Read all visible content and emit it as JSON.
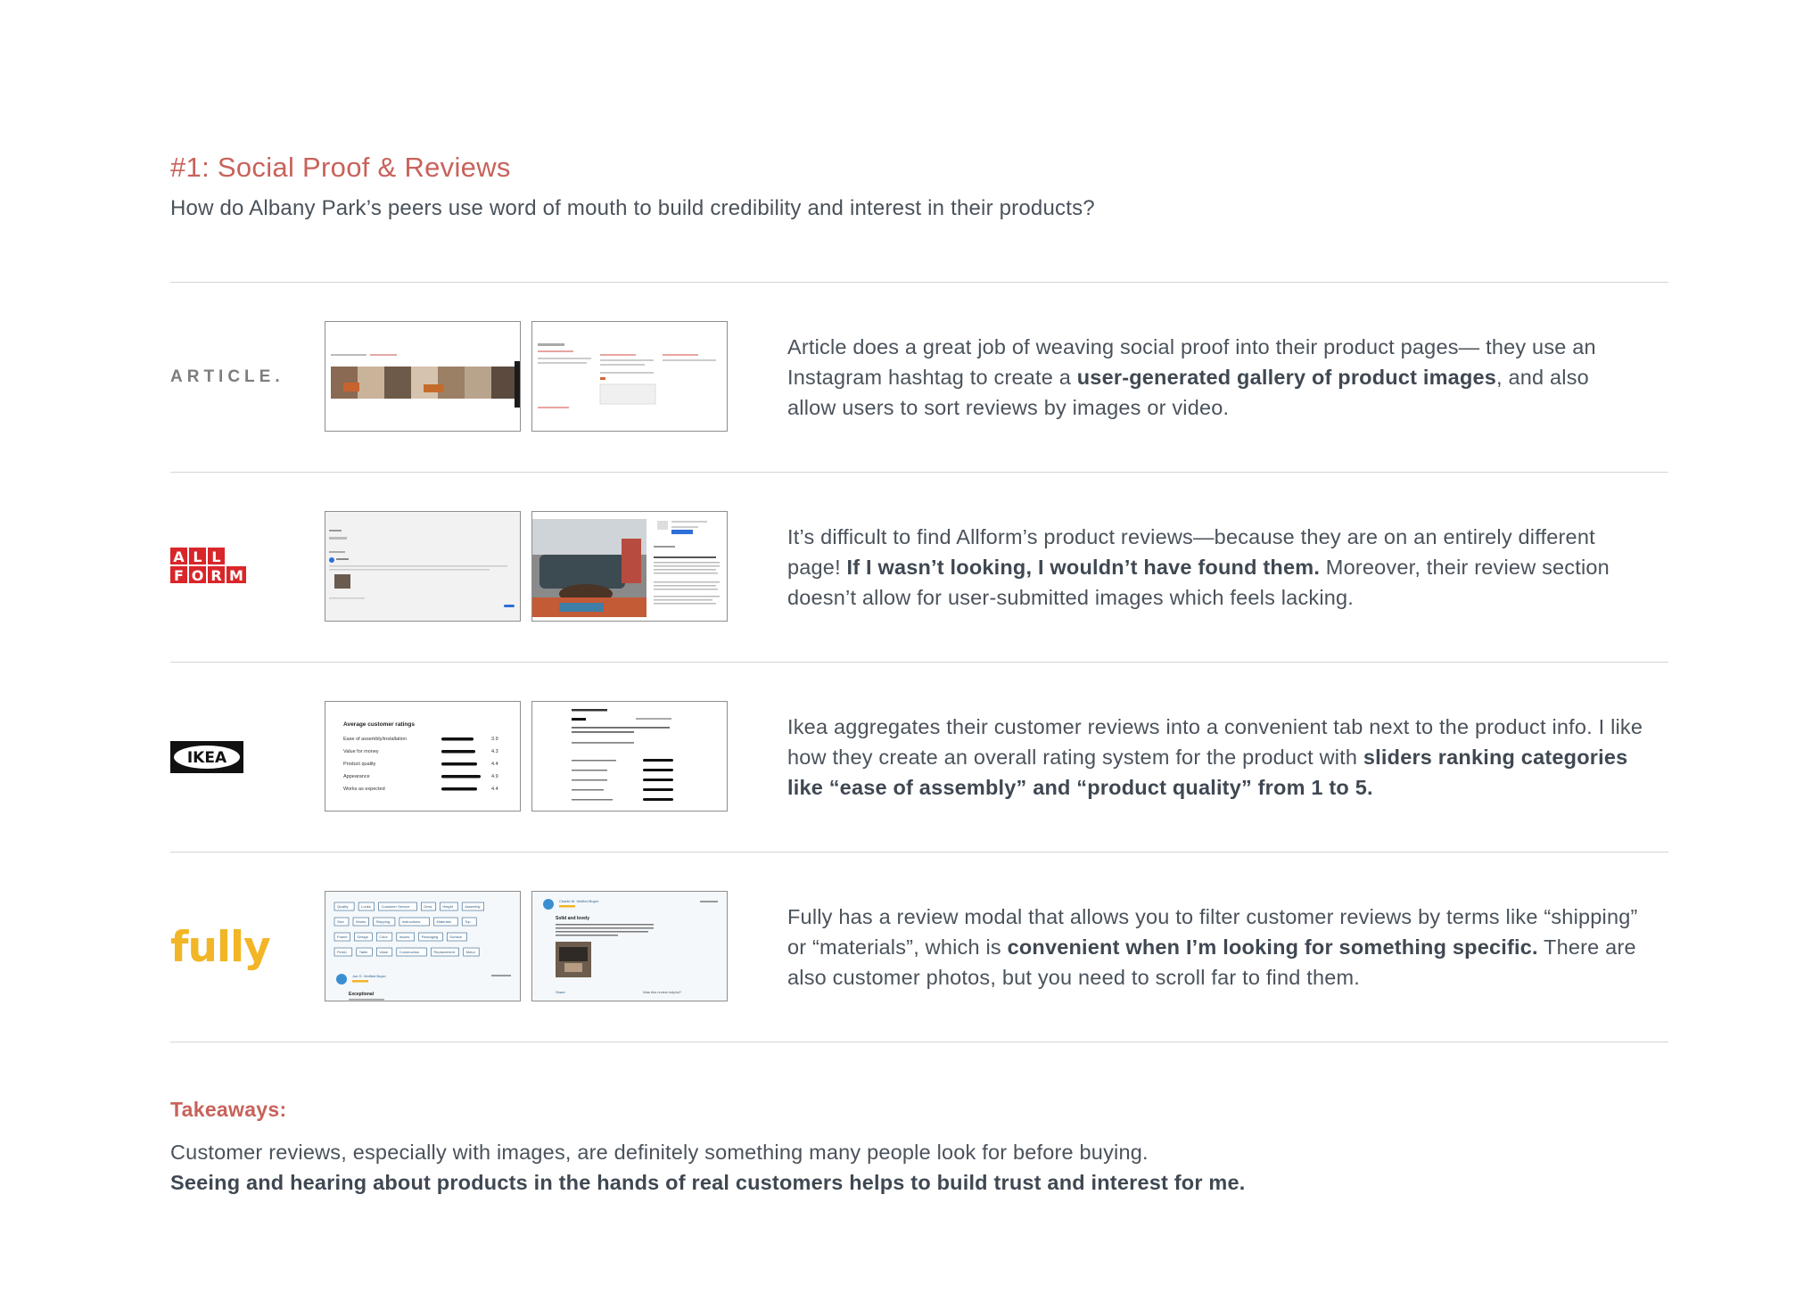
{
  "header": {
    "title": "#1: Social Proof & Reviews",
    "subtitle": "How do Albany Park’s peers use word of mouth to build credibility and interest in their products?"
  },
  "brands": [
    {
      "name": "Article",
      "logo_text": "ARTICLE.",
      "desc": {
        "t1": "Article does a great job of weaving social proof into their product pages— they use an Instagram hashtag to create a ",
        "b1": "user-generated gallery of product images",
        "t2": ", and also allow users to sort reviews by images or video."
      }
    },
    {
      "name": "Allform",
      "logo_text": [
        "A",
        "L",
        "L",
        "F",
        "O",
        "R",
        "M"
      ],
      "desc": {
        "t1": "It’s difficult to find Allform’s product reviews—because they are on an entirely different page! ",
        "b1": "If I wasn’t looking, I wouldn’t have found them.",
        "t2": " Moreover, their review section doesn’t allow for user-submitted images which feels lacking."
      }
    },
    {
      "name": "Ikea",
      "logo_text": "IKEA",
      "thumb1": {
        "heading": "Average customer ratings",
        "rows": [
          {
            "label": "Ease of assembly/installation",
            "value": "3.9"
          },
          {
            "label": "Value for money",
            "value": "4.3"
          },
          {
            "label": "Product quality",
            "value": "4.4"
          },
          {
            "label": "Appearance",
            "value": "4.9"
          },
          {
            "label": "Works as expected",
            "value": "4.4"
          }
        ]
      },
      "desc": {
        "t1": "Ikea aggregates their customer reviews into a convenient tab next to the product info. I like how they create an overall rating system for the product with ",
        "b1": "sliders ranking categories like “ease of assembly” and “product quality” from 1 to 5.",
        "t2": ""
      }
    },
    {
      "name": "Fully",
      "logo_text": "fully",
      "thumb1": {
        "tags": [
          "Quality",
          "Looks",
          "Customer Service",
          "Desk",
          "Height",
          "Assembly",
          "Size",
          "Works",
          "Shipping",
          "Instructions",
          "Materials",
          "Top",
          "Frame",
          "Design",
          "Color",
          "Issues",
          "Packaging",
          "Surface",
          "Finish",
          "Table",
          "Value",
          "Construction",
          "Replacement",
          "Motor"
        ],
        "reviewer": "Joe G. Verified Buyer",
        "review_title": "Exceptional"
      },
      "thumb2": {
        "reviewer": "Charlie M. Verified Buyer",
        "review_title": "Solid and lovely",
        "share": "Share",
        "helpful": "Was this review helpful?"
      },
      "desc": {
        "t1": "Fully has a review modal that allows you to filter customer reviews by terms like “shipping” or “materials”, which is ",
        "b1": "convenient when I’m looking for something specific.",
        "t2": " There are also customer photos, but you need to scroll far to find them."
      }
    }
  ],
  "takeaways": {
    "title": "Takeaways:",
    "line1": "Customer reviews, especially with images, are definitely something many people look for before buying.",
    "line2": "Seeing and hearing about products in the hands of real customers helps to build trust and interest for me."
  },
  "colors": {
    "accent": "#c8625b",
    "text": "#4a525b",
    "rule": "#d5d5d5",
    "allform_red": "#d9262a",
    "fully_yellow": "#f2b526"
  }
}
